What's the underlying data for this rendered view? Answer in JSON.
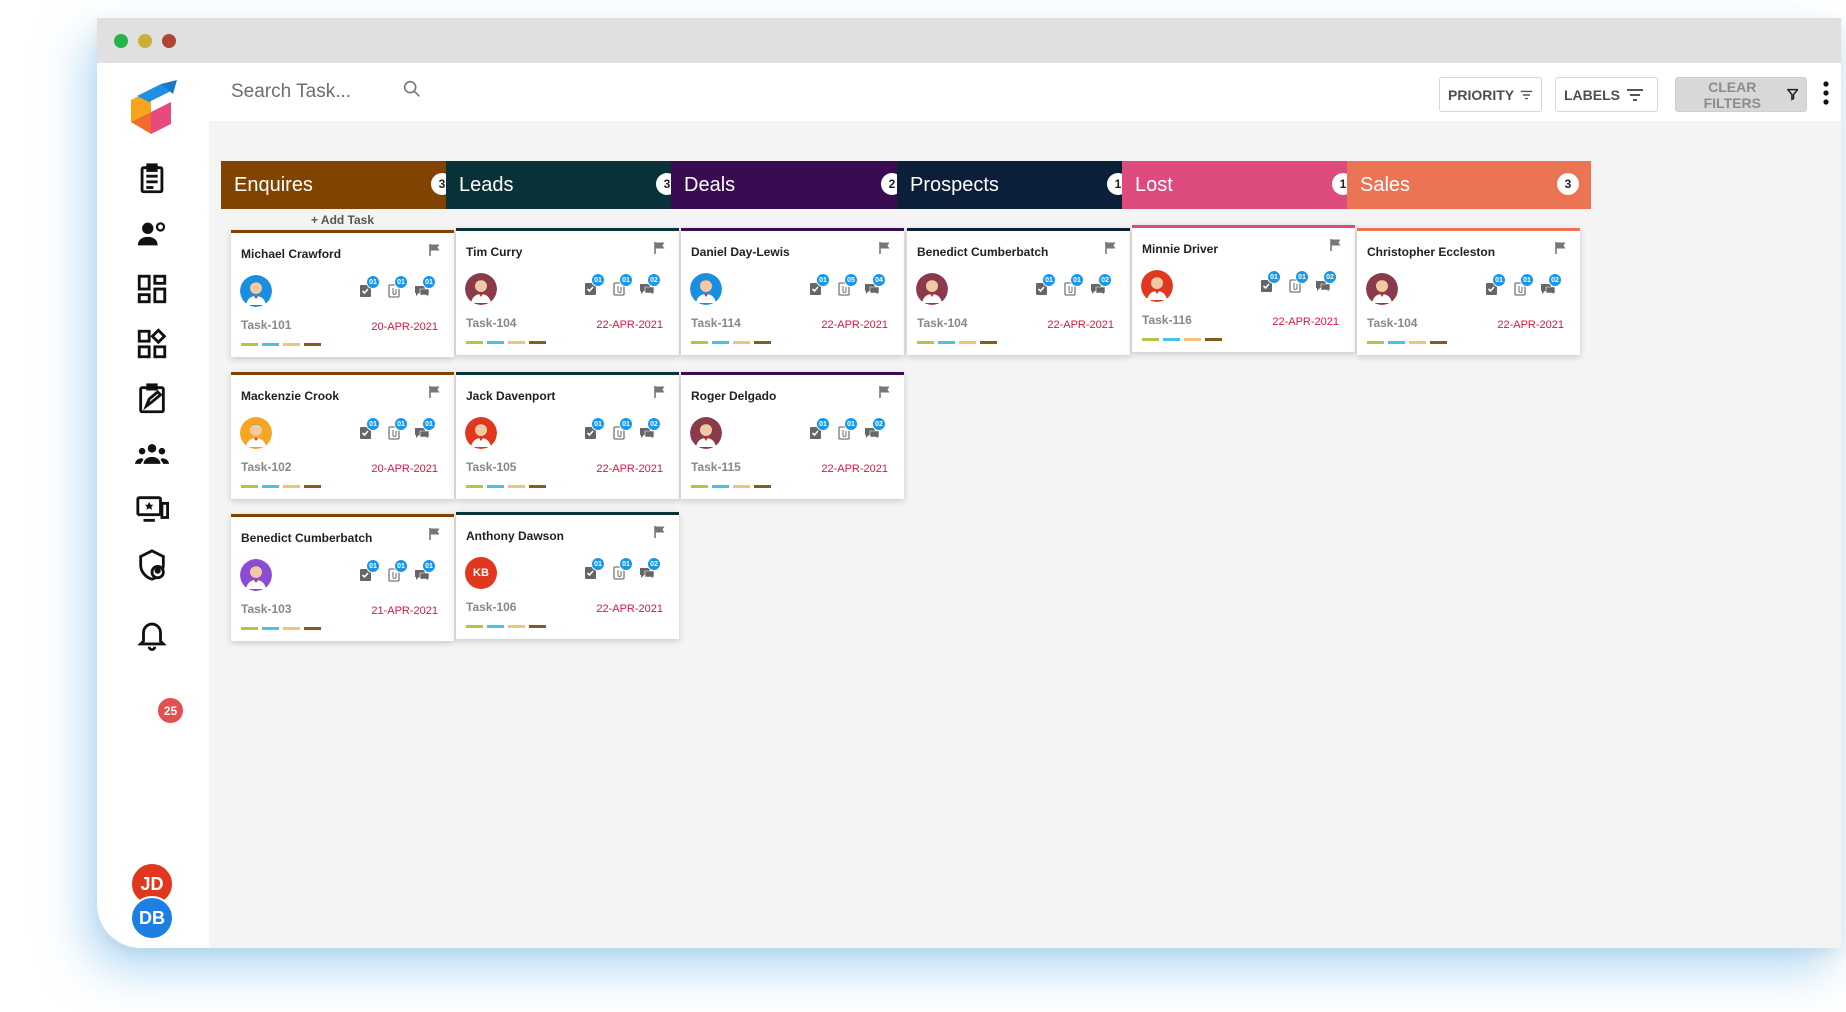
{
  "search": {
    "placeholder": "Search Task..."
  },
  "toolbar": {
    "priority_label": "PRIORITY",
    "labels_label": "LABELS",
    "clear_label": "CLEAR FILTERS"
  },
  "sidebar": {
    "notification_count": "25",
    "user1_initials": "JD",
    "user2_initials": "DB"
  },
  "add_task_label": "+ Add Task",
  "label_colors": [
    "#b7c24a",
    "#46c3e6",
    "#f3c17a",
    "#8b5a1b"
  ],
  "columns": [
    {
      "title": "Enquires",
      "count": "3",
      "color": "#804300"
    },
    {
      "title": "Leads",
      "count": "3",
      "color": "#093138"
    },
    {
      "title": "Deals",
      "count": "2",
      "color": "#3a0a52"
    },
    {
      "title": "Prospects",
      "count": "1",
      "color": "#0b1f3a"
    },
    {
      "title": "Lost",
      "count": "1",
      "color": "#dc4a7e"
    },
    {
      "title": "Sales",
      "count": "3",
      "color": "#ea7454"
    }
  ],
  "cards": [
    {
      "name": "Michael Crawford",
      "task": "Task-101",
      "date": "20-APR-2021",
      "avatar": "blue",
      "m1": "01",
      "m2": "01",
      "m3": "01"
    },
    {
      "name": "Mackenzie Crook",
      "task": "Task-102",
      "date": "20-APR-2021",
      "avatar": "orange",
      "m1": "01",
      "m2": "01",
      "m3": "01"
    },
    {
      "name": "Benedict Cumberbatch",
      "task": "Task-103",
      "date": "21-APR-2021",
      "avatar": "purple",
      "m1": "01",
      "m2": "01",
      "m3": "01"
    },
    {
      "name": "Tim Curry",
      "task": "Task-104",
      "date": "22-APR-2021",
      "avatar": "maroon",
      "m1": "01",
      "m2": "01",
      "m3": "02"
    },
    {
      "name": "Jack Davenport",
      "task": "Task-105",
      "date": "22-APR-2021",
      "avatar": "red",
      "m1": "01",
      "m2": "01",
      "m3": "02"
    },
    {
      "name": "Anthony Dawson",
      "task": "Task-106",
      "date": "22-APR-2021",
      "avatar": "KB",
      "m1": "01",
      "m2": "01",
      "m3": "02"
    },
    {
      "name": "Daniel Day-Lewis",
      "task": "Task-114",
      "date": "22-APR-2021",
      "avatar": "blue",
      "m1": "01",
      "m2": "05",
      "m3": "04"
    },
    {
      "name": "Roger Delgado",
      "task": "Task-115",
      "date": "22-APR-2021",
      "avatar": "maroon",
      "m1": "01",
      "m2": "01",
      "m3": "02"
    },
    {
      "name": "Benedict Cumberbatch",
      "task": "Task-104",
      "date": "22-APR-2021",
      "avatar": "maroon",
      "m1": "01",
      "m2": "01",
      "m3": "02"
    },
    {
      "name": "Minnie Driver",
      "task": "Task-116",
      "date": "22-APR-2021",
      "avatar": "red",
      "m1": "01",
      "m2": "01",
      "m3": "02"
    },
    {
      "name": "Christopher Eccleston",
      "task": "Task-104",
      "date": "22-APR-2021",
      "avatar": "maroon",
      "m1": "01",
      "m2": "01",
      "m3": "02"
    }
  ]
}
